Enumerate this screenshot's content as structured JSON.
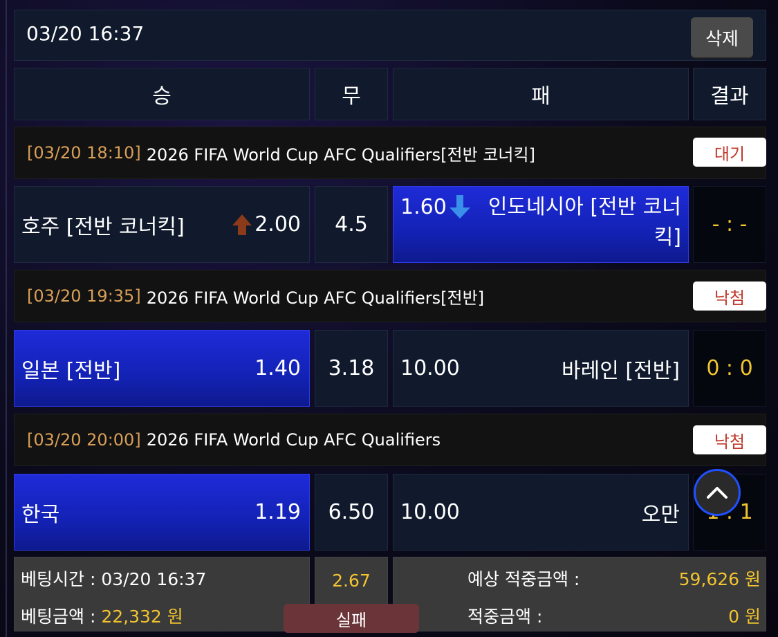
{
  "header": {
    "datetime": "03/20 16:37",
    "delete_label": "삭제"
  },
  "columns": {
    "win": "승",
    "draw": "무",
    "lose": "패",
    "result": "결과"
  },
  "matches": [
    {
      "time": "[03/20 18:10]",
      "league": "2026 FIFA World Cup AFC Qualifiers[전반 코너킥]",
      "status": "대기",
      "home": "호주 [전반 코너킥]",
      "home_odds": "2.00",
      "home_trend": "up",
      "draw": "4.5",
      "away_odds": "1.60",
      "away_trend": "down",
      "away_line1": "인도네시아 [전반 코너",
      "away_line2": "킥]",
      "result": "- : -",
      "selected": "away"
    },
    {
      "time": "[03/20 19:35]",
      "league": "2026 FIFA World Cup AFC Qualifiers[전반]",
      "status": "낙첨",
      "home": "일본 [전반]",
      "home_odds": "1.40",
      "draw": "3.18",
      "away_odds": "10.00",
      "away": "바레인 [전반]",
      "result": "0 : 0",
      "selected": "home"
    },
    {
      "time": "[03/20 20:00]",
      "league": "2026 FIFA World Cup AFC Qualifiers",
      "status": "낙첨",
      "home": "한국",
      "home_odds": "1.19",
      "draw": "6.50",
      "away_odds": "10.00",
      "away": "오만",
      "result": "1 : 1",
      "selected": "home"
    }
  ],
  "footer": {
    "bet_time_label": "베팅시간 : ",
    "bet_time": "03/20 16:37",
    "bet_amount_label": "베팅금액 : ",
    "bet_amount": "22,332 원",
    "total_odds": "2.67",
    "result_label": "실패",
    "expected_label": "예상 적중금액 :",
    "expected_value": "59,626 원",
    "hit_label": "적중금액 :",
    "hit_value": "0 원"
  },
  "colors": {
    "selected_blue": "#1e2bd8",
    "time_orange": "#d89f57",
    "score_yellow": "#f2c430",
    "status_red": "#c0392b",
    "up_arrow": "#8b3a1a",
    "down_arrow": "#3a8fe8"
  },
  "icons": {
    "scroll_top": "chevron-up-icon",
    "trend_up": "arrow-up-icon",
    "trend_down": "arrow-down-icon"
  }
}
